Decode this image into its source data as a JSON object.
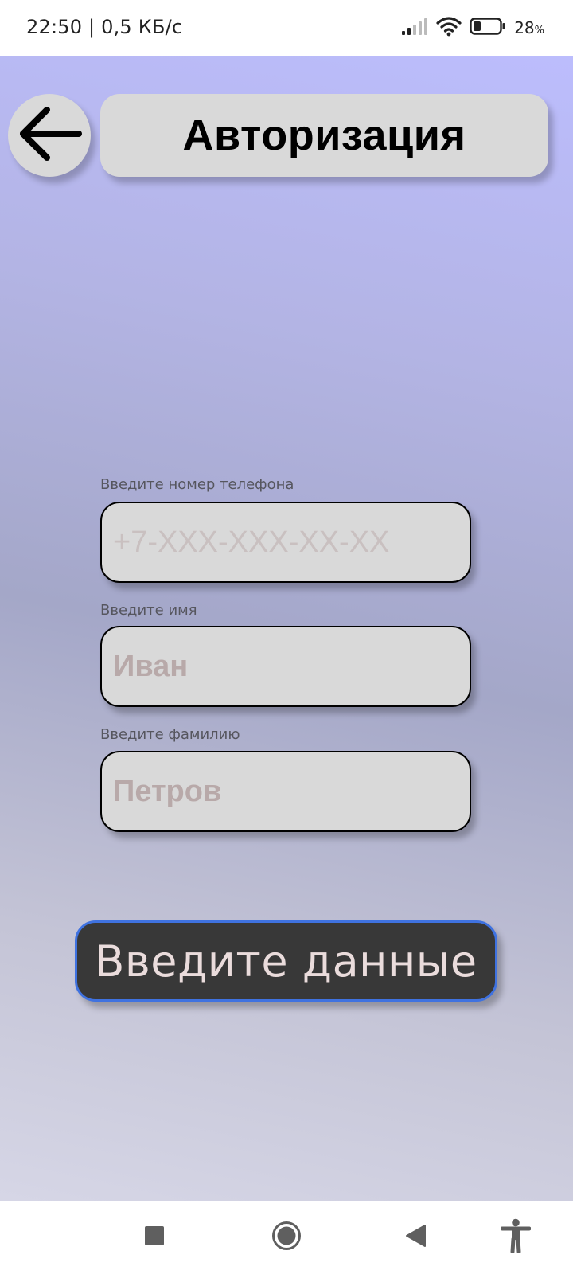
{
  "status_bar": {
    "time_speed": "22:50 | 0,5 КБ/с",
    "battery_percent": "28",
    "battery_unit": "%",
    "battery_level": 0.28,
    "icons": [
      "signal-icon",
      "wifi-icon",
      "battery-icon"
    ]
  },
  "header": {
    "back_icon": "arrow-left-icon",
    "title": "Авторизация"
  },
  "form": {
    "phone": {
      "label": "Введите номер телефона",
      "placeholder": "+7-XXX-XXX-XX-XX",
      "value": ""
    },
    "first_name": {
      "label": "Введите имя",
      "placeholder": "Иван",
      "value": ""
    },
    "last_name": {
      "label": "Введите фамилию",
      "placeholder": "Петров",
      "value": ""
    },
    "submit_label": "Введите данные"
  },
  "nav_bar": {
    "icons": [
      "recents-square-icon",
      "home-circle-icon",
      "back-triangle-icon",
      "accessibility-icon"
    ]
  },
  "colors": {
    "app_gradient_top": "#bcbdfd",
    "app_gradient_bottom": "#d6d6e6",
    "panel_gray": "#d9d9d9",
    "submit_bg": "#383838",
    "submit_border": "#3f72e0",
    "submit_text": "#eadcdc",
    "placeholder_muted": "#b8a9a9"
  }
}
